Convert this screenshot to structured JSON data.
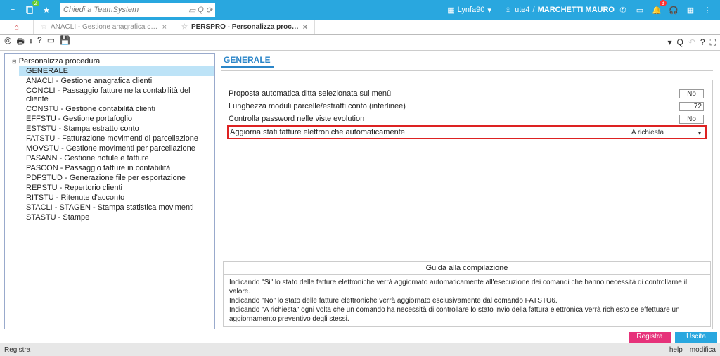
{
  "topbar": {
    "search_placeholder": "Chiedi a TeamSystem",
    "doc_badge": "2",
    "bell_badge": "3",
    "lynfa": "Lynfa90",
    "user_id": "ute4",
    "user_name": "MARCHETTI MAURO",
    "user_sep": "/"
  },
  "tabs": {
    "t0": {
      "label": "ANACLI - Gestione anagrafica clienti"
    },
    "t1": {
      "label": "PERSPRO - Personalizza procedura"
    }
  },
  "tree": {
    "root": "Personalizza procedura",
    "items": [
      "GENERALE",
      "ANACLI - Gestione anagrafica clienti",
      "CONCLI - Passaggio fatture nella contabilità del cliente",
      "CONSTU - Gestione contabilità clienti",
      "EFFSTU - Gestione portafoglio",
      "ESTSTU - Stampa estratto conto",
      "FATSTU - Fatturazione movimenti di parcellazione",
      "MOVSTU - Gestione movimenti per parcellazione",
      "PASANN - Gestione notule e fatture",
      "PASCON - Passaggio fatture in contabilità",
      "PDFSTUD - Generazione file per esportazione",
      "REPSTU - Repertorio clienti",
      "RITSTU - Ritenute d'acconto",
      "STACLI - STAGEN - Stampa statistica movimenti",
      "STASTU - Stampe"
    ]
  },
  "section_header": "GENERALE",
  "form": {
    "r0": {
      "label": "Proposta automatica ditta selezionata sul menù",
      "value": "No"
    },
    "r1": {
      "label": "Lunghezza moduli parcelle/estratti conto (interlinee)",
      "value": "72"
    },
    "r2": {
      "label": "Controlla password nelle viste evolution",
      "value": "No"
    },
    "r3": {
      "label": "Aggiorna stati fatture elettroniche automaticamente",
      "value": "A richiesta"
    }
  },
  "guide": {
    "title": "Guida alla compilazione",
    "body": "Indicando \"Si\" lo stato delle fatture elettroniche verrà aggiornato automaticamente all'esecuzione dei comandi che hanno necessità di controllarne il valore.\nIndicando \"No\" lo stato delle fatture elettroniche verrà aggiornato esclusivamente dal comando FATSTU6.\nIndicando \"A richiesta\" ogni volta che un comando ha necessità di controllare lo stato invio della fattura elettronica verrà richiesto se effettuare un aggiornamento preventivo degli stessi."
  },
  "footer": {
    "registra_btn": "Registra",
    "uscita_btn": "Uscita",
    "status_left": "Registra",
    "status_help": "help",
    "status_modifica": "modifica"
  }
}
